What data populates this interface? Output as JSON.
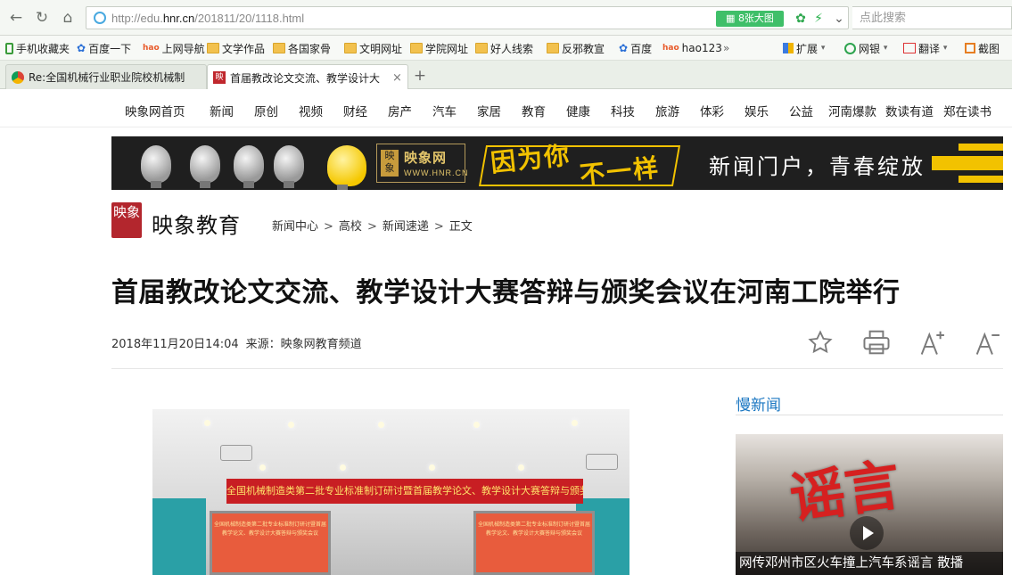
{
  "browser": {
    "url_prefix": "http://edu.",
    "url_domain": "hnr.cn",
    "url_path": "/201811/20/1118.html",
    "image_badge": "8张大图",
    "search_placeholder": "点此搜索",
    "bookmarks": [
      "手机收藏夹",
      "百度一下",
      "上网导航",
      "文学作品",
      "各国家骨",
      "文明网址",
      "学院网址",
      "好人线索",
      "反邪教宣",
      "百度",
      "hao123"
    ],
    "more_chevron": "»",
    "extensions": [
      "扩展",
      "网银",
      "翻译",
      "截图"
    ],
    "tabs": [
      {
        "title": "Re:全国机械行业职业院校机械制",
        "active": false
      },
      {
        "title": "首届教改论文交流、教学设计大",
        "active": true
      }
    ],
    "new_tab_label": "+",
    "tab_close": "×"
  },
  "site_nav": {
    "items": [
      "映象网首页",
      "新闻",
      "原创",
      "视频",
      "财经",
      "房产",
      "汽车",
      "家居",
      "教育",
      "健康",
      "科技",
      "旅游",
      "体彩",
      "娱乐",
      "公益",
      "河南爆款",
      "数读有道",
      "郑在读书"
    ]
  },
  "banner": {
    "logo_seal": "映象",
    "logo_main": "映象网",
    "logo_sub": "WWW.HNR.CN",
    "slogan_line1": "因为你",
    "slogan_line2": "不一样",
    "tagline": "新闻门户，青春绽放"
  },
  "brand": {
    "seal_text": "映象",
    "name": "映象教育"
  },
  "breadcrumb": {
    "items": [
      "新闻中心",
      "高校",
      "新闻速递",
      "正文"
    ],
    "separator": ">"
  },
  "article": {
    "title": "首届教改论文交流、教学设计大赛答辩与颁奖会议在河南工院举行",
    "date": "2018年11月20日14:04",
    "source": "来源：映象网教育频道",
    "photo_banner_text": "全国机械制造类第二批专业标准制订研讨暨首届教学论文、教学设计大赛答辩与颁奖会议",
    "photo_screen_text": "全国机械制造类第二批专业标准制订研讨暨首届教学论文、教学设计大赛答辩与颁奖会议"
  },
  "toolbar": {
    "icons": [
      "star-icon",
      "printer-icon",
      "font-increase-icon",
      "font-decrease-icon"
    ]
  },
  "sidebar": {
    "heading": "慢新闻",
    "image_text": "谣言",
    "caption": "网传邓州市区火车撞上汽车系谣言 散播"
  },
  "colors": {
    "accent_blue": "#1b77c2",
    "brand_red": "#b3262d",
    "banner_yellow": "#f2c200",
    "badge_green": "#3fbf69"
  }
}
